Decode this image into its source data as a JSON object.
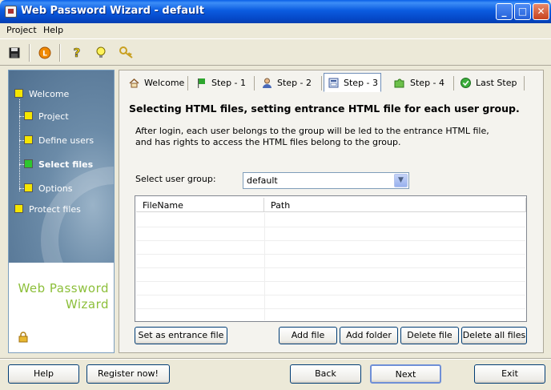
{
  "window": {
    "title": "Web Password Wizard - default"
  },
  "menu": [
    "Project",
    "Help"
  ],
  "sidebar": {
    "items": [
      {
        "label": "Welcome",
        "active": false
      },
      {
        "label": "Project",
        "active": false
      },
      {
        "label": "Define users",
        "active": false
      },
      {
        "label": "Select files",
        "active": true
      },
      {
        "label": "Options",
        "active": false
      },
      {
        "label": "Protect files",
        "active": false
      }
    ],
    "brand_line1": "Web  Password",
    "brand_line2": "Wizard"
  },
  "tabs": [
    {
      "label": "Welcome",
      "icon": "house-icon"
    },
    {
      "label": "Step - 1",
      "icon": "flag-icon"
    },
    {
      "label": "Step - 2",
      "icon": "user-icon"
    },
    {
      "label": "Step - 3",
      "icon": "files-icon",
      "selected": true
    },
    {
      "label": "Step - 4",
      "icon": "puzzle-icon"
    },
    {
      "label": "Last Step",
      "icon": "check-icon"
    }
  ],
  "step": {
    "heading": "Selecting HTML files, setting entrance HTML file for each user group.",
    "desc_line1": "After login, each user belongs to the group will be led to the entrance HTML file,",
    "desc_line2": "and has rights to access the HTML files belong to the group.",
    "group_label": "Select user group:",
    "group_value": "default"
  },
  "table": {
    "columns": [
      "FileName",
      "Path"
    ],
    "rows": []
  },
  "actions": {
    "set_entrance": "Set as entrance file",
    "add_file": "Add file",
    "add_folder": "Add folder",
    "delete_file": "Delete file",
    "delete_all": "Delete all files"
  },
  "footer": {
    "help": "Help",
    "register": "Register now!",
    "back": "Back",
    "next": "Next",
    "exit": "Exit"
  },
  "colors": {
    "accent": "#0a5fe8",
    "brand": "#8cbf3a",
    "active_step": "#2ec62e"
  }
}
